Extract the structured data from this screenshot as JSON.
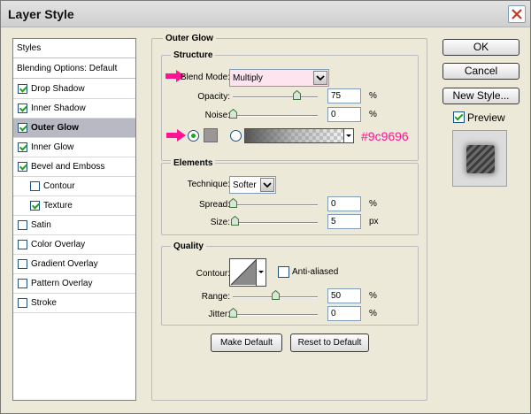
{
  "window": {
    "title": "Layer Style"
  },
  "styles_panel": {
    "header": "Styles",
    "blending_options": "Blending Options: Default",
    "items": [
      {
        "label": "Drop Shadow",
        "checked": true
      },
      {
        "label": "Inner Shadow",
        "checked": true
      },
      {
        "label": "Outer Glow",
        "checked": true,
        "selected": true
      },
      {
        "label": "Inner Glow",
        "checked": true
      },
      {
        "label": "Bevel and Emboss",
        "checked": true
      },
      {
        "label": "Contour",
        "checked": false,
        "indented": true
      },
      {
        "label": "Texture",
        "checked": true,
        "indented": true
      },
      {
        "label": "Satin",
        "checked": false
      },
      {
        "label": "Color Overlay",
        "checked": false
      },
      {
        "label": "Gradient Overlay",
        "checked": false
      },
      {
        "label": "Pattern Overlay",
        "checked": false
      },
      {
        "label": "Stroke",
        "checked": false
      }
    ]
  },
  "outer_glow": {
    "title": "Outer Glow",
    "structure": {
      "title": "Structure",
      "blend_mode_label": "Blend Mode:",
      "blend_mode_value": "Multiply",
      "opacity_label": "Opacity:",
      "opacity_value": "75",
      "opacity_unit": "%",
      "opacity_level": 0.75,
      "noise_label": "Noise:",
      "noise_value": "0",
      "noise_unit": "%",
      "noise_level": 0,
      "glow_color_hex": "#9c9696",
      "color_annotation": "#9c9696",
      "annotation_color": "#ff1493"
    },
    "elements": {
      "title": "Elements",
      "technique_label": "Technique:",
      "technique_value": "Softer",
      "spread_label": "Spread:",
      "spread_value": "0",
      "spread_unit": "%",
      "spread_level": 0,
      "size_label": "Size:",
      "size_value": "5",
      "size_unit": "px",
      "size_level": 0.02
    },
    "quality": {
      "title": "Quality",
      "contour_label": "Contour:",
      "anti_aliased_label": "Anti-aliased",
      "anti_aliased_checked": false,
      "range_label": "Range:",
      "range_value": "50",
      "range_unit": "%",
      "range_level": 0.5,
      "jitter_label": "Jitter:",
      "jitter_value": "0",
      "jitter_unit": "%",
      "jitter_level": 0
    },
    "make_default_label": "Make Default",
    "reset_default_label": "Reset to Default"
  },
  "right_panel": {
    "ok_label": "OK",
    "cancel_label": "Cancel",
    "new_style_label": "New Style...",
    "preview_label": "Preview",
    "preview_checked": true
  }
}
